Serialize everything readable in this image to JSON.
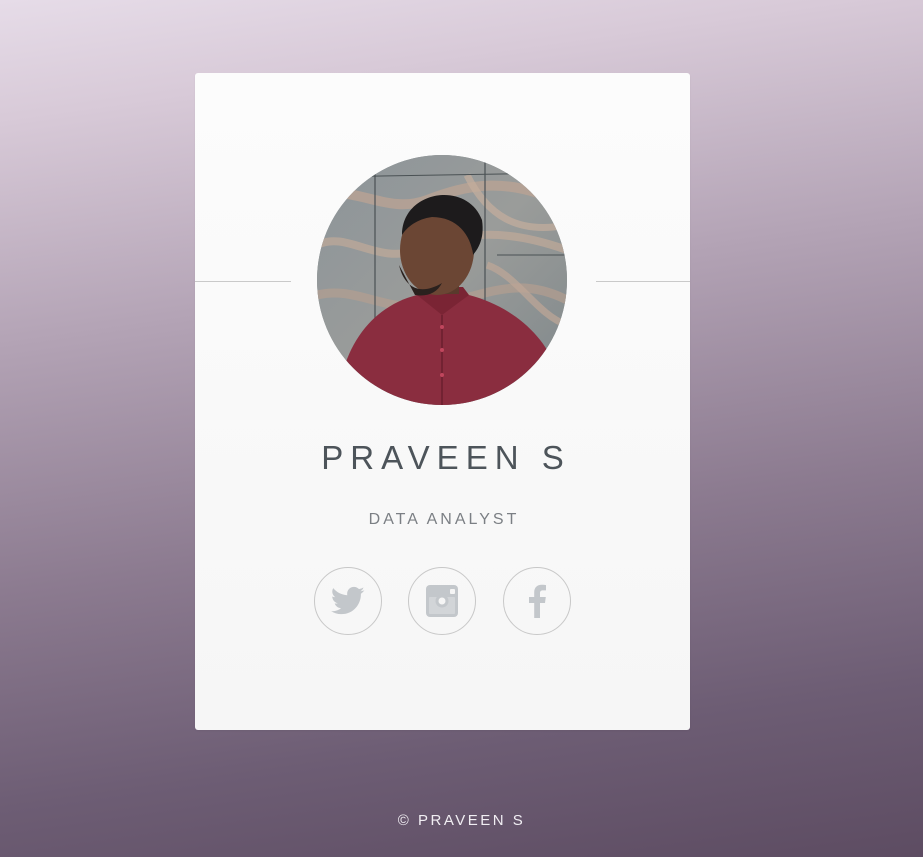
{
  "profile": {
    "name": "PRAVEEN S",
    "role": "DATA ANALYST",
    "photo": "profile-photo"
  },
  "social": [
    {
      "label": "Twitter",
      "icon": "twitter-icon"
    },
    {
      "label": "Instagram",
      "icon": "instagram-icon"
    },
    {
      "label": "Facebook",
      "icon": "facebook-icon"
    }
  ],
  "footer": {
    "copyright": "© PRAVEEN S"
  },
  "colors": {
    "card_background": "#fafafa",
    "name_text": "#4d545a",
    "icon_gray": "#c3c7cb",
    "background_top": "#e6dce8",
    "background_bottom": "#5d4c62"
  }
}
